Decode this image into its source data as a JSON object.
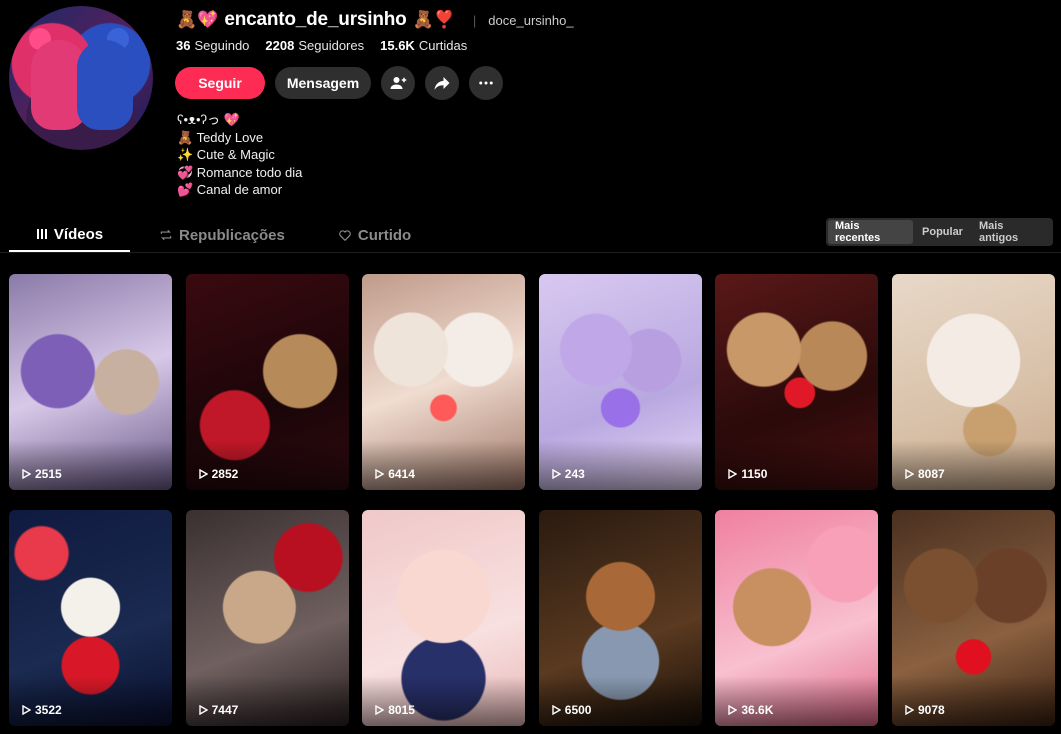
{
  "profile": {
    "username": "encanto_de_ursinho",
    "name_prefix_emoji": "🧸💖",
    "name_suffix_emoji": "🧸❣️",
    "nickname": "doce_ursinho_",
    "separator": "|"
  },
  "stats": [
    {
      "value": "36",
      "label": "Seguindo"
    },
    {
      "value": "2208",
      "label": "Seguidores"
    },
    {
      "value": "15.6K",
      "label": "Curtidas"
    }
  ],
  "actions": {
    "follow_label": "Seguir",
    "message_label": "Mensagem"
  },
  "bio": [
    "ʕ•ᴥ•ʔっ 💖",
    "🧸 Teddy Love",
    "✨ Cute & Magic",
    "💞 Romance todo dia",
    "💕 Canal de amor"
  ],
  "tabs": [
    {
      "label": "Vídeos",
      "active": true
    },
    {
      "label": "Republicações",
      "active": false
    },
    {
      "label": "Curtido",
      "active": false
    }
  ],
  "sort_options": [
    {
      "label": "Mais recentes",
      "active": true
    },
    {
      "label": "Popular",
      "active": false
    },
    {
      "label": "Mais antigos",
      "active": false
    }
  ],
  "colors": {
    "accent": "#fe2c55",
    "background": "#000000",
    "button_secondary": "#2f2f2f"
  },
  "videos": [
    {
      "views": "2515"
    },
    {
      "views": "2852"
    },
    {
      "views": "6414"
    },
    {
      "views": "243"
    },
    {
      "views": "1150"
    },
    {
      "views": "8087"
    },
    {
      "views": "3522"
    },
    {
      "views": "7447"
    },
    {
      "views": "8015"
    },
    {
      "views": "6500"
    },
    {
      "views": "36.6K"
    },
    {
      "views": "9078"
    }
  ]
}
